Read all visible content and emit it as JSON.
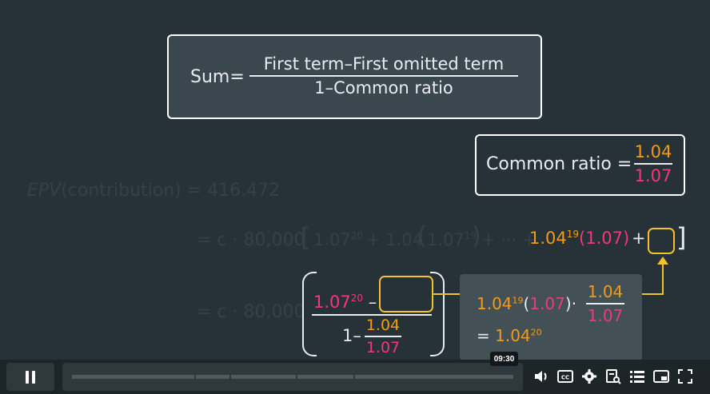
{
  "sum_formula": {
    "lhs": "Sum",
    "eq": "=",
    "numerator": "First term–First omitted term",
    "denominator": "1–Common ratio"
  },
  "ratio_formula": {
    "lhs": "Common ratio",
    "eq": "=",
    "numerator": "1.04",
    "denominator": "1.07"
  },
  "epv_line": {
    "epv": "EPV",
    "arg": "(contribution)",
    "rest": " = 416.472"
  },
  "line2": {
    "prefix": "= c · 80,000",
    "open_bracket": "[",
    "t1_base": "1.07",
    "t1_exp": "20",
    "plus1": "+ 1.04",
    "t2_paren_open": "(",
    "t2_base": "1.07",
    "t2_exp": "19",
    "t2_paren_close": ")",
    "dots": "+ ··· +",
    "t3_base": "1.04",
    "t3_exp": "19",
    "t3_paren": "(1.07)",
    "plus2": "+",
    "close_bracket": "]"
  },
  "line3": {
    "prefix": "= c · 80,000",
    "num_base": "1.07",
    "num_exp": "20",
    "minus": "–",
    "den_one": "1–",
    "den_num": "1.04",
    "den_den": "1.07"
  },
  "callout": {
    "base": "1.04",
    "exp": "19",
    "paren_open": "(",
    "paren_val": "1.07",
    "paren_close": ")",
    "dot": "·",
    "frac_num": "1.04",
    "frac_den": "1.07",
    "eq": "=",
    "res_base": "1.04",
    "res_exp": "20"
  },
  "player": {
    "time_tooltip": "09:30",
    "progress_fraction": 0.97
  },
  "colors": {
    "orange": "#f39a1b",
    "pink": "#ee3a78",
    "yellow": "#f2c12e",
    "background": "#263237"
  }
}
